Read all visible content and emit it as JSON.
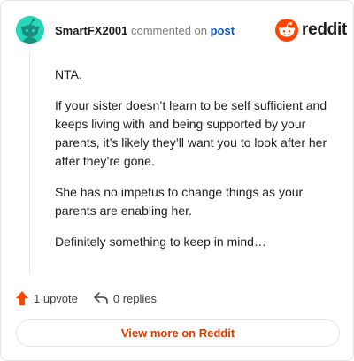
{
  "header": {
    "username": "SmartFX2001",
    "action_text": " commented on ",
    "post_link": "post",
    "logo_text": "reddit"
  },
  "comment": {
    "paragraphs": [
      "NTA.",
      "If your sister doesn’t learn to be self sufficient and keeps living with and being supported by your parents, it’s likely they’ll want you to look after her after they’re gone.",
      "She has no impetus to change things as your parents are enabling her.",
      "Definitely something to keep in mind…"
    ]
  },
  "footer": {
    "upvotes_label": "1 upvote",
    "replies_label": "0 replies",
    "view_more_label": "View more on Reddit"
  },
  "colors": {
    "accent_orange": "#d93a00",
    "upvote_orange": "#ff4500",
    "avatar_bg": "#28d6b8",
    "link_blue": "#0a57c2"
  },
  "icons": {
    "avatar": "snoo-avatar-icon",
    "logo": "reddit-snoo-logo-icon",
    "upvote": "upvote-arrow-icon",
    "reply": "reply-arrow-icon"
  }
}
